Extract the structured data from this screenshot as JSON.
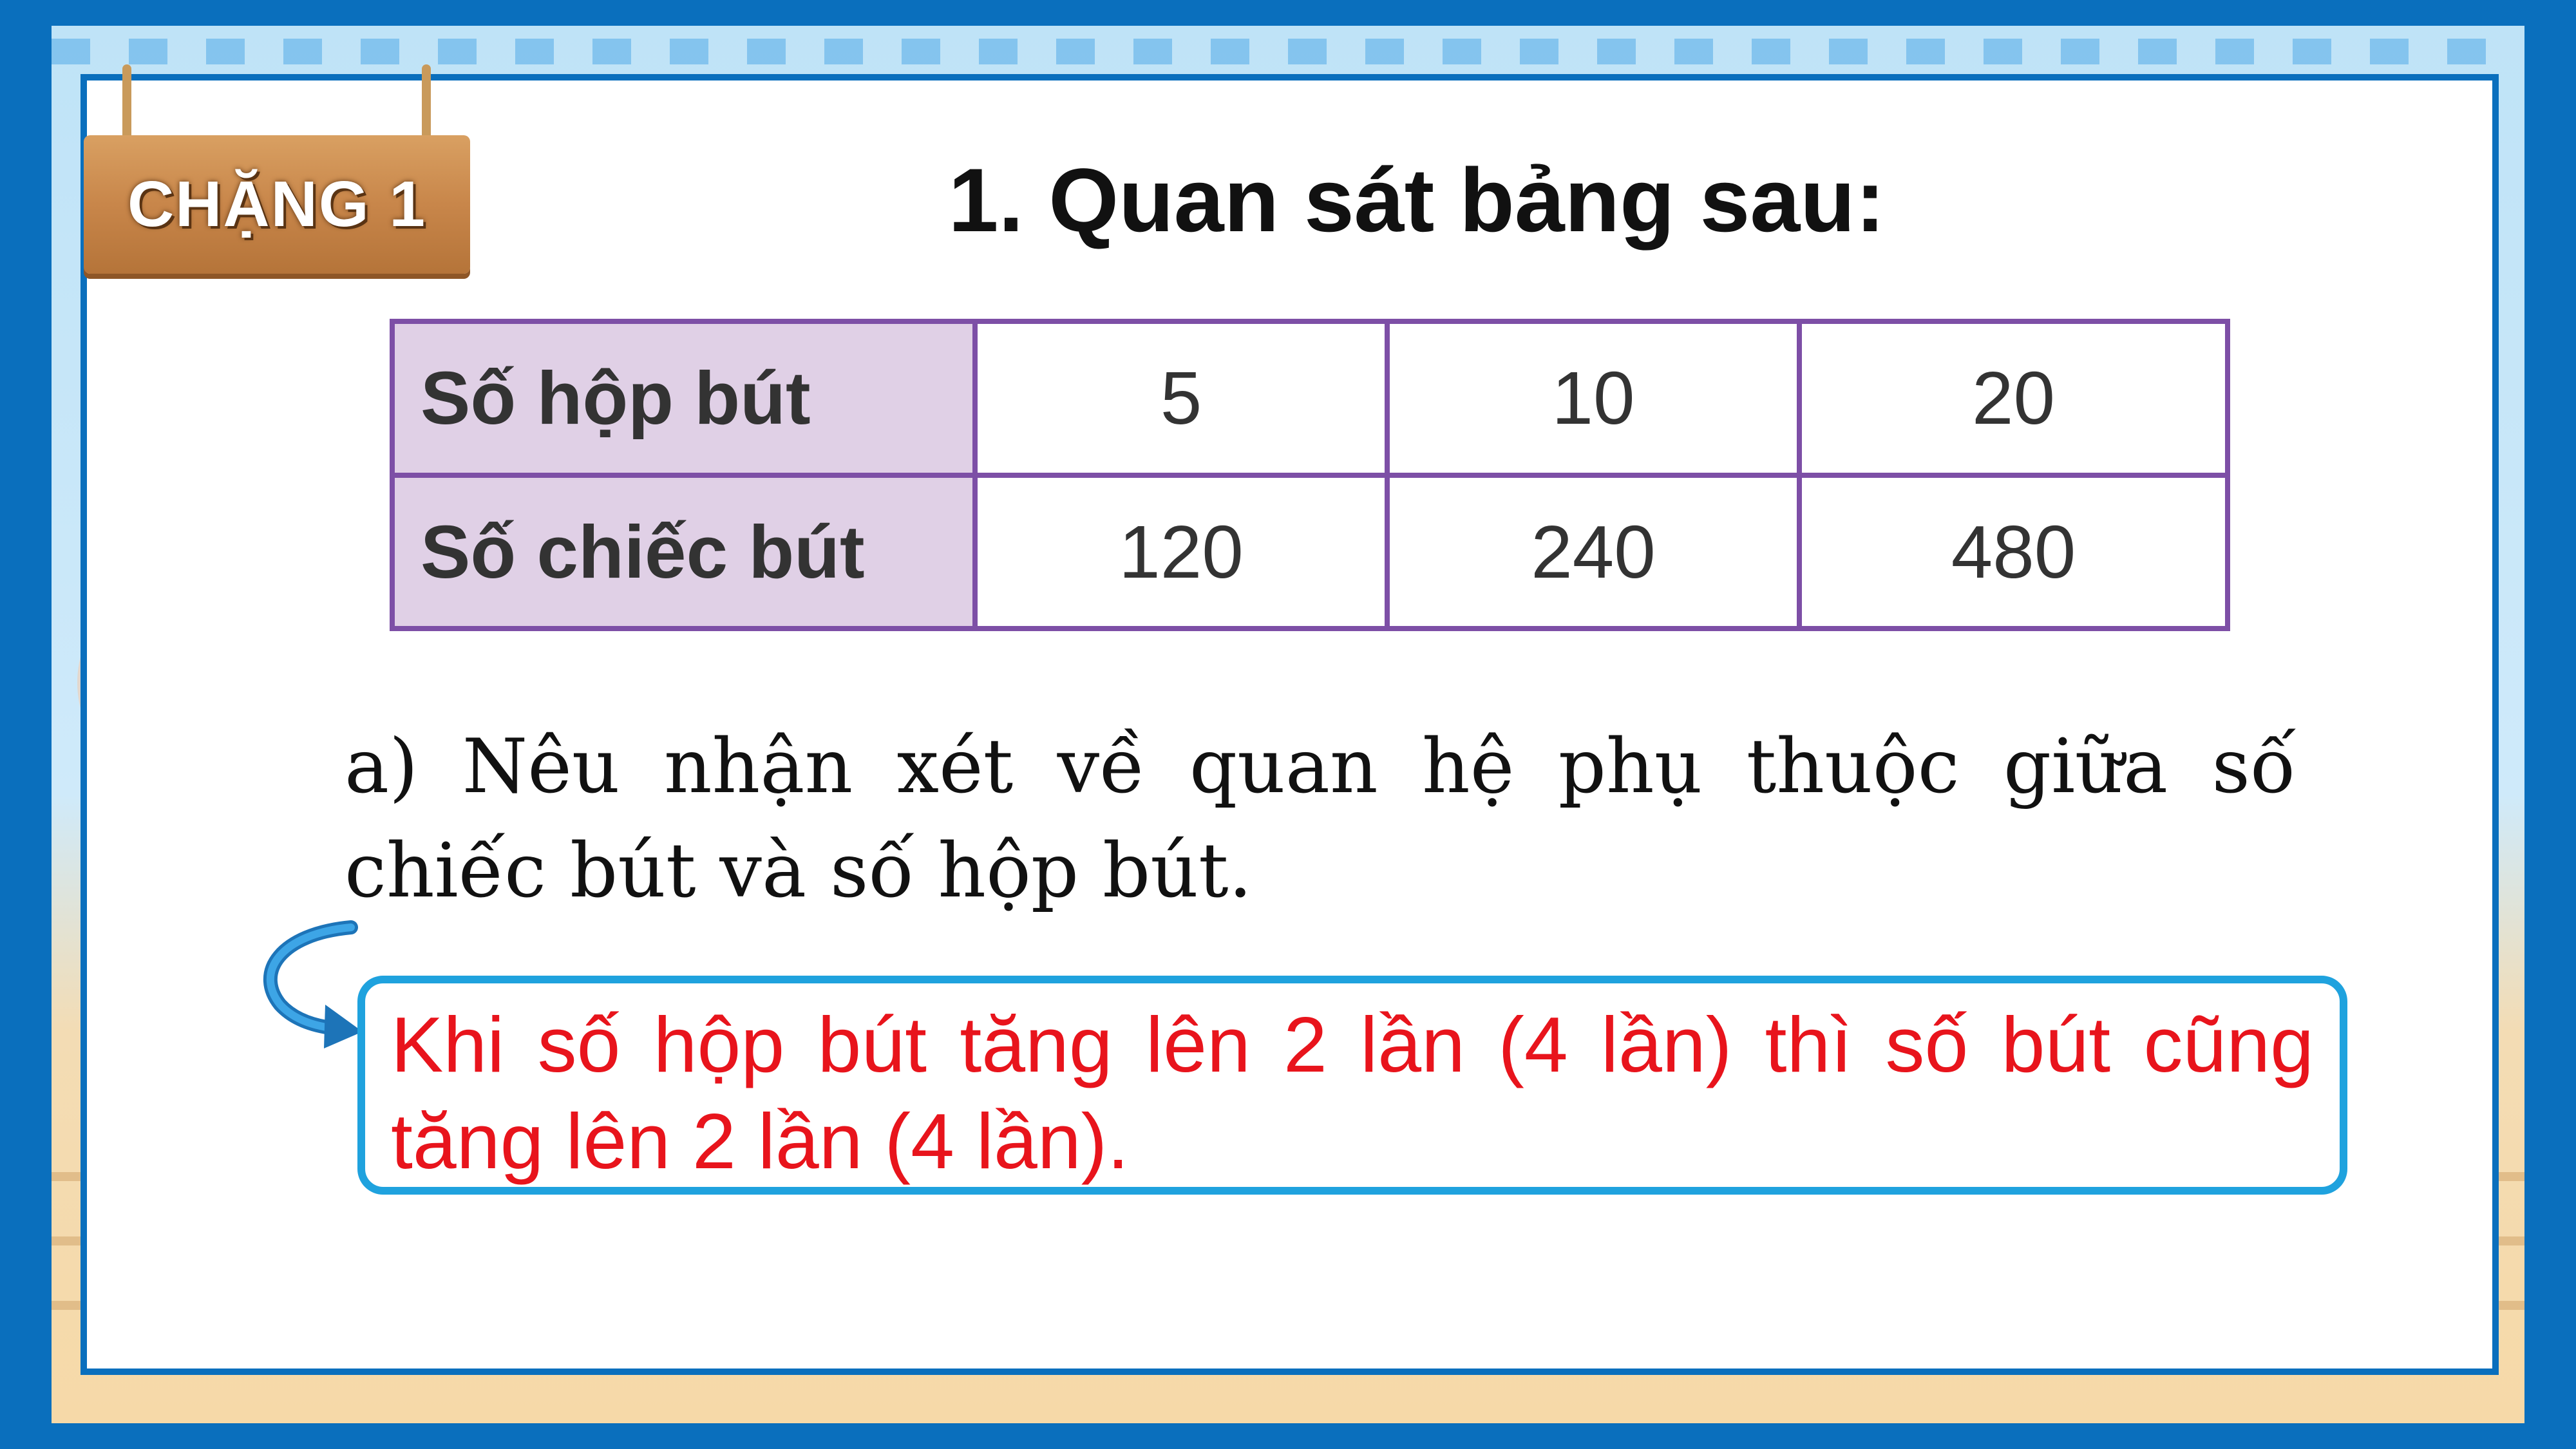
{
  "sign": {
    "label": "CHẶNG 1"
  },
  "title": "1. Quan sát bảng sau:",
  "table": {
    "rows": [
      {
        "header": "Số hộp bút",
        "values": [
          "5",
          "10",
          "20"
        ]
      },
      {
        "header": "Số chiếc bút",
        "values": [
          "120",
          "240",
          "480"
        ]
      }
    ]
  },
  "question": "a) Nêu nhận xét về quan hệ phụ thuộc giữa số chiếc bút và số hộp bút.",
  "answer": "Khi số hộp bút tăng lên 2 lần (4 lần) thì số bút cũng tăng lên 2 lần (4 lần).",
  "colors": {
    "frame": "#0a6fbd",
    "table_border": "#7d4fa6",
    "table_header_bg": "#e0d0e6",
    "answer_border": "#1fa2de",
    "answer_text": "#e8141c",
    "sign_wood": "#c8864a"
  },
  "icons": {
    "answer_pointer": "curved-arrow-icon"
  }
}
